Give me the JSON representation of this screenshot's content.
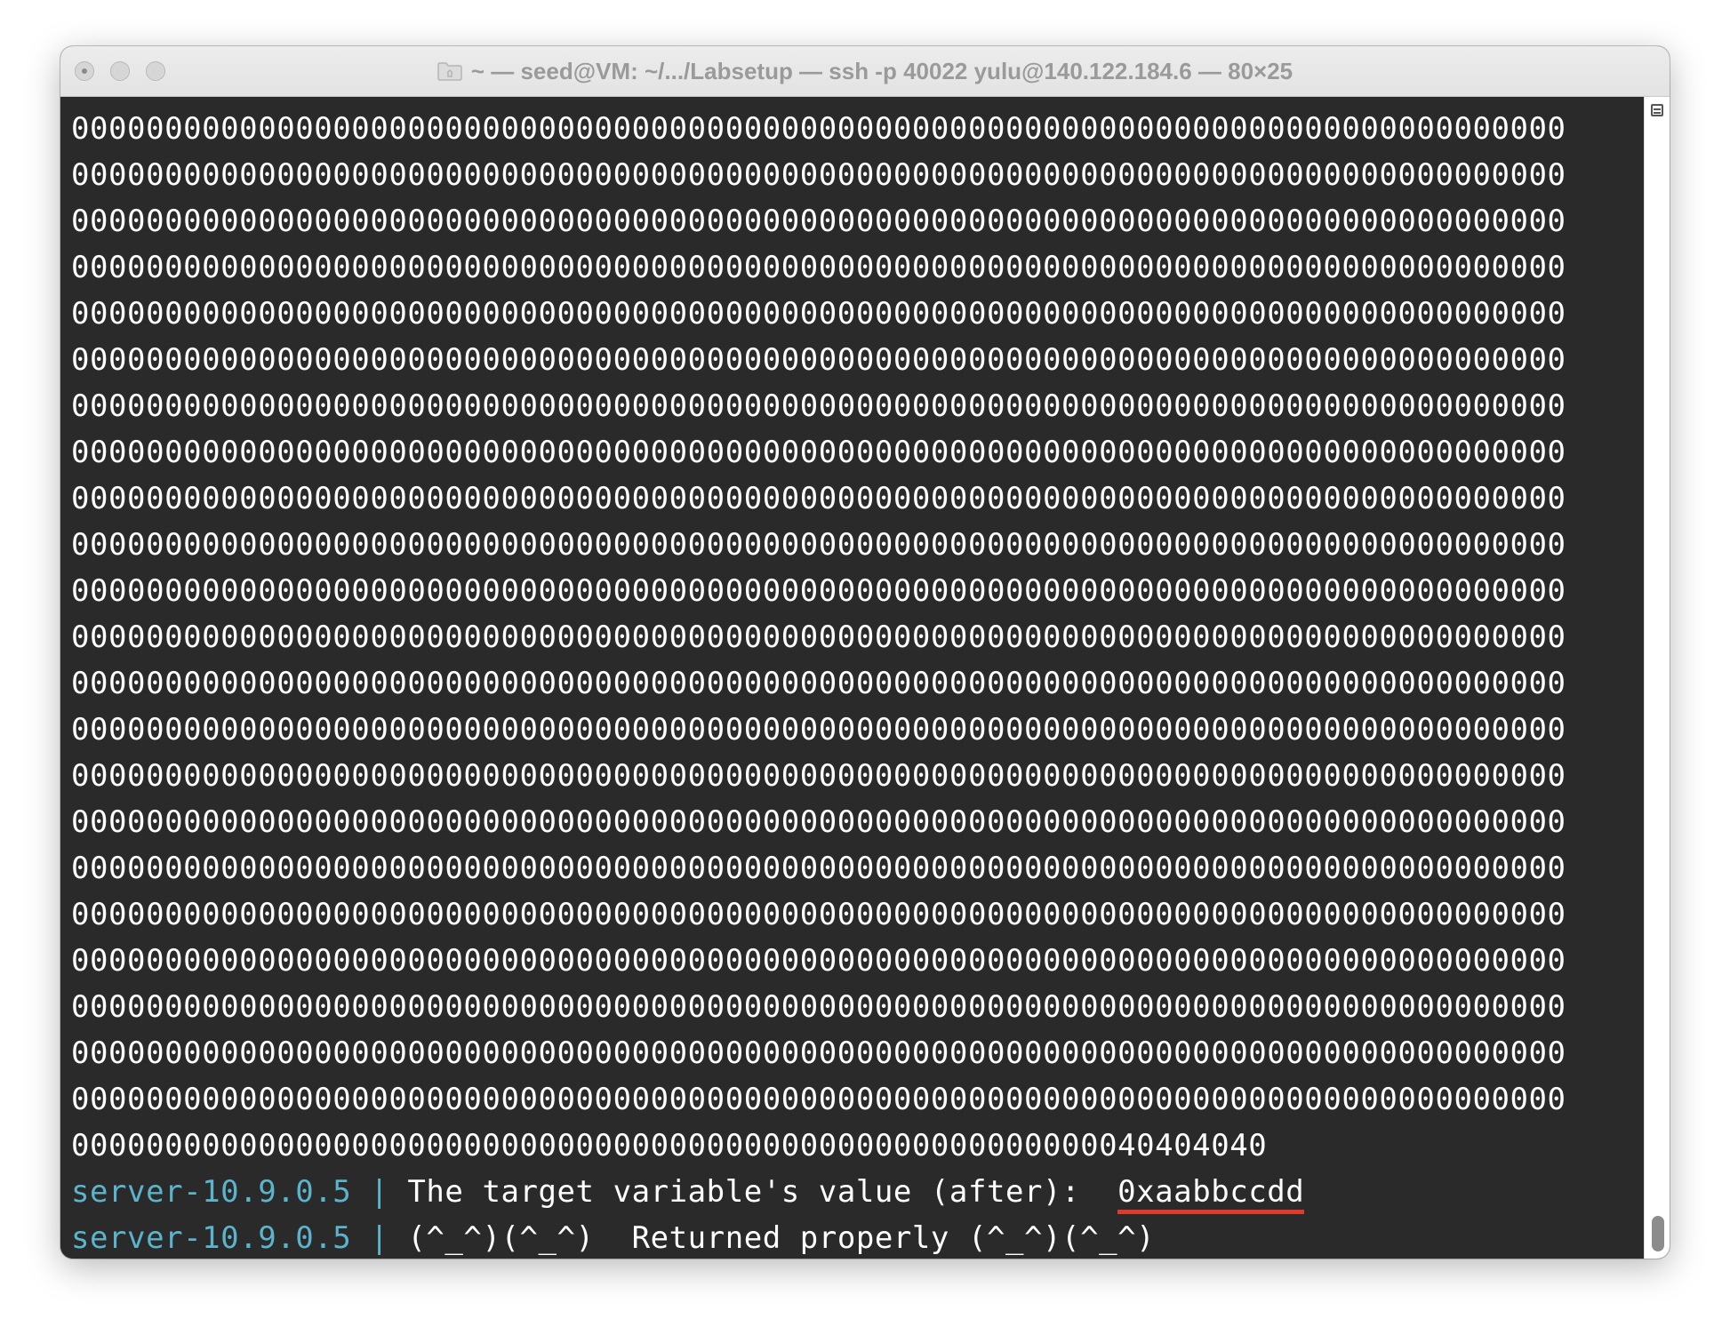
{
  "window": {
    "title": "~ — seed@VM: ~/.../Labsetup — ssh -p 40022 yulu@140.122.184.6 — 80×25"
  },
  "terminal": {
    "zero_lines": [
      "00000000000000000000000000000000000000000000000000000000000000000000000000000000",
      "00000000000000000000000000000000000000000000000000000000000000000000000000000000",
      "00000000000000000000000000000000000000000000000000000000000000000000000000000000",
      "00000000000000000000000000000000000000000000000000000000000000000000000000000000",
      "00000000000000000000000000000000000000000000000000000000000000000000000000000000",
      "00000000000000000000000000000000000000000000000000000000000000000000000000000000",
      "00000000000000000000000000000000000000000000000000000000000000000000000000000000",
      "00000000000000000000000000000000000000000000000000000000000000000000000000000000",
      "00000000000000000000000000000000000000000000000000000000000000000000000000000000",
      "00000000000000000000000000000000000000000000000000000000000000000000000000000000",
      "00000000000000000000000000000000000000000000000000000000000000000000000000000000",
      "00000000000000000000000000000000000000000000000000000000000000000000000000000000",
      "00000000000000000000000000000000000000000000000000000000000000000000000000000000",
      "00000000000000000000000000000000000000000000000000000000000000000000000000000000",
      "00000000000000000000000000000000000000000000000000000000000000000000000000000000",
      "00000000000000000000000000000000000000000000000000000000000000000000000000000000",
      "00000000000000000000000000000000000000000000000000000000000000000000000000000000",
      "00000000000000000000000000000000000000000000000000000000000000000000000000000000",
      "00000000000000000000000000000000000000000000000000000000000000000000000000000000",
      "00000000000000000000000000000000000000000000000000000000000000000000000000000000",
      "00000000000000000000000000000000000000000000000000000000000000000000000000000000",
      "00000000000000000000000000000000000000000000000000000000000000000000000000000000",
      "0000000000000000000000000000000000000000000000000000000040404040"
    ],
    "line1": {
      "prefix": "server-10.9.0.5 | ",
      "text": "The target variable's value (after):  ",
      "highlight": "0xaabbccdd"
    },
    "line2": {
      "prefix": "server-10.9.0.5 | ",
      "text": "(^_^)(^_^)  Returned properly (^_^)(^_^)"
    }
  },
  "colors": {
    "background": "#2a2a2a",
    "prefix": "#5bb4cb",
    "underline": "#e03a2f",
    "cursor": "#5ed65b"
  }
}
